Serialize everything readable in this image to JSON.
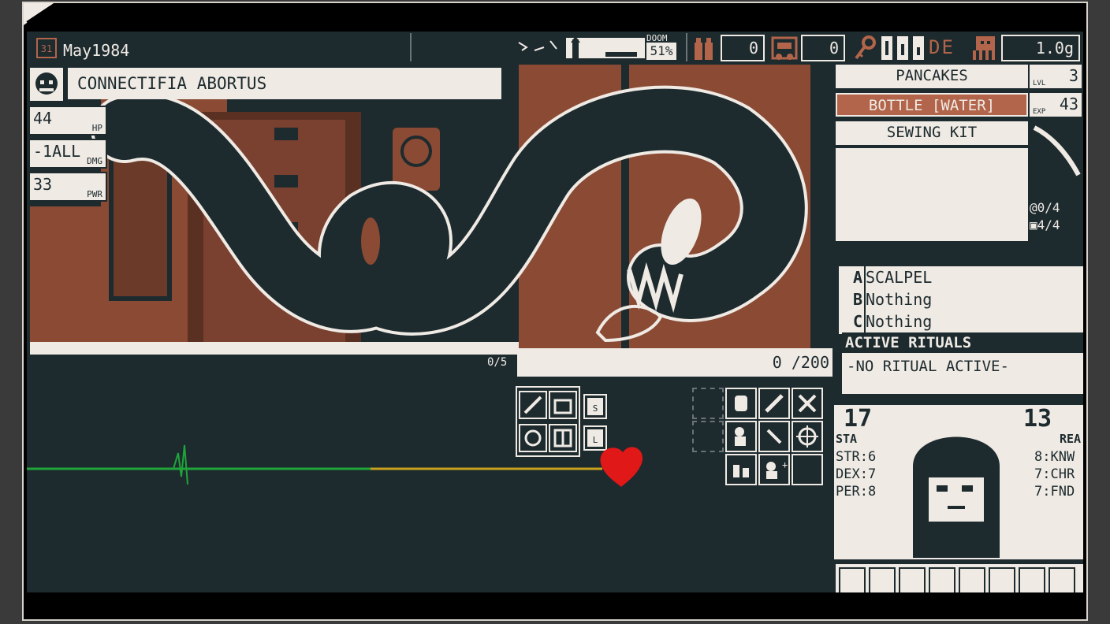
{
  "topbar": {
    "date_day": "31",
    "date": "May1984",
    "doom_label": "DOOM",
    "doom_value": "51%",
    "ammo": "0",
    "food": "0",
    "key_letters": "DE",
    "funds": "1.0g"
  },
  "enemy": {
    "name": "CONNECTIFIA ABORTUS",
    "hp": "44",
    "hp_label": "HP",
    "damage": "-1ALL",
    "damage_label": "DMG",
    "power": "33",
    "power_label": "PWR"
  },
  "battle": {
    "charge_current": "0",
    "charge_max": "/200",
    "charge_display": "0 /200",
    "pen_counter": "0/5",
    "save_label": "S",
    "load_label": "L"
  },
  "inventory": {
    "items": [
      {
        "label": "PANCAKES",
        "selected": false
      },
      {
        "label": "BOTTLE [WATER]",
        "selected": true
      },
      {
        "label": "SEWING KIT",
        "selected": false
      }
    ],
    "level": "3",
    "level_label": "LVL",
    "exp": "43",
    "exp_label": "EXP",
    "spells_count": "0/4",
    "bag_count": "4/4"
  },
  "equipment": {
    "slots": [
      {
        "key": "A",
        "label": "SCALPEL"
      },
      {
        "key": "B",
        "label": "Nothing"
      },
      {
        "key": "C",
        "label": "Nothing"
      }
    ]
  },
  "rituals": {
    "header": "ACTIVE RITUALS",
    "status": "-NO RITUAL ACTIVE-"
  },
  "character": {
    "stamina": "17",
    "stamina_label": "STA",
    "reason": "13",
    "reason_label": "REA",
    "str": "STR:6",
    "dex": "DEX:7",
    "per": "PER:8",
    "knw": "8:KNW",
    "chr": "7:CHR",
    "fnd": "7:FND"
  },
  "colors": {
    "bg": "#1d2a2e",
    "cream": "#efeae4",
    "rust": "#b2654a",
    "wood": "#8a4a34",
    "green": "#1fa53a",
    "gold": "#c9a21d",
    "heart": "#e01818"
  }
}
